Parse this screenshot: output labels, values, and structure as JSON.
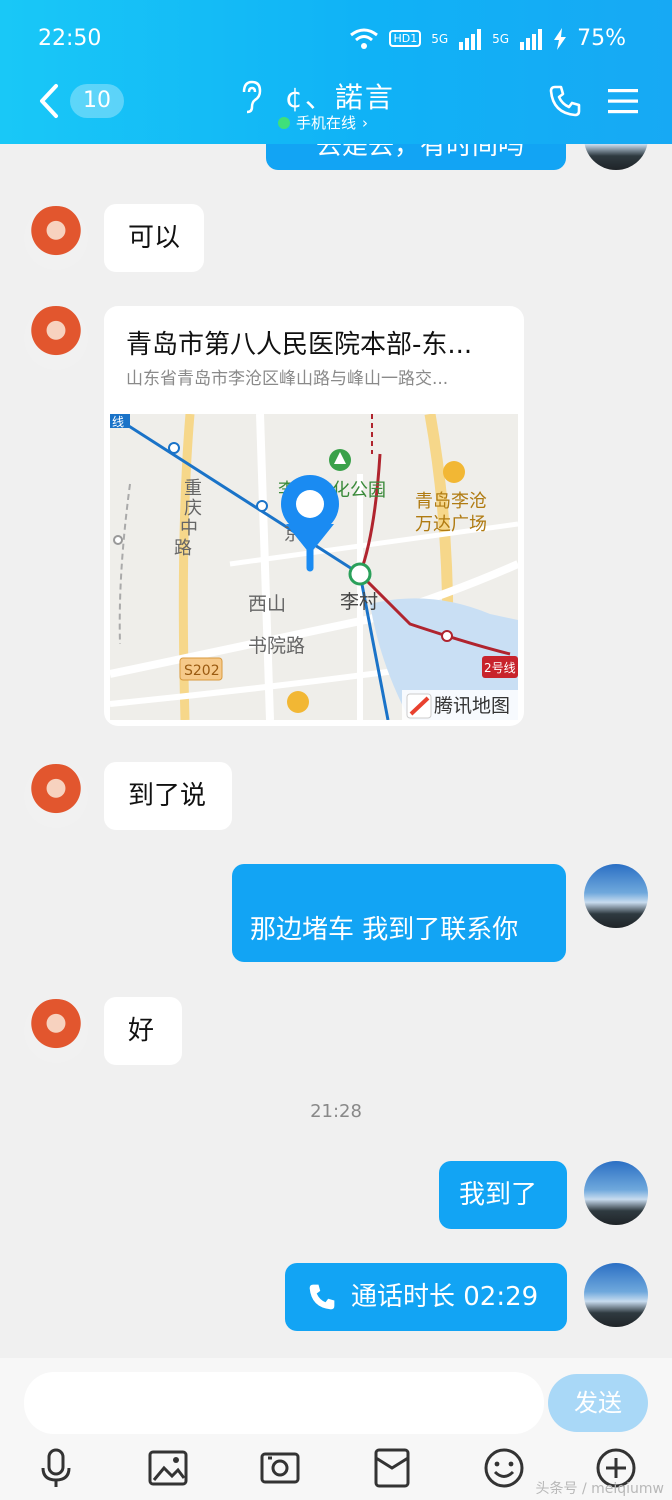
{
  "status_bar": {
    "time": "22:50",
    "network_hd": "HD1",
    "net1": "5G",
    "net2": "5G",
    "battery": "75%"
  },
  "header": {
    "unread_count": "10",
    "contact_name": "¢、諾言",
    "online_status": "手机在线",
    "online_chevron": "›"
  },
  "messages": {
    "partial_top": "去是去，有时间吗",
    "m1": "可以",
    "location": {
      "title": "青岛市第八人民医院本部-东...",
      "address": "山东省青岛市李沧区峰山路与峰山一路交...",
      "map_labels": {
        "park": "李沧文化公园",
        "mall1": "青岛李沧",
        "mall2": "万达广场",
        "road1": "重",
        "road2": "庆",
        "road3": "中",
        "road4": "路",
        "west_mountain": "西山",
        "shuyuan_road": "书院路",
        "licun": "李村",
        "jingkou": "京口",
        "s202": "S202",
        "line2": "2号线",
        "line_top": "线",
        "brand": "腾讯地图"
      }
    },
    "m2": "到了说",
    "m3": "那边堵车 我到了联系你",
    "m4": "好",
    "timestamp": "21:28",
    "m5": "我到了",
    "call": "通话时长 02:29"
  },
  "input": {
    "send_label": "发送"
  },
  "watermark": "头条号 / meiqiumw"
}
